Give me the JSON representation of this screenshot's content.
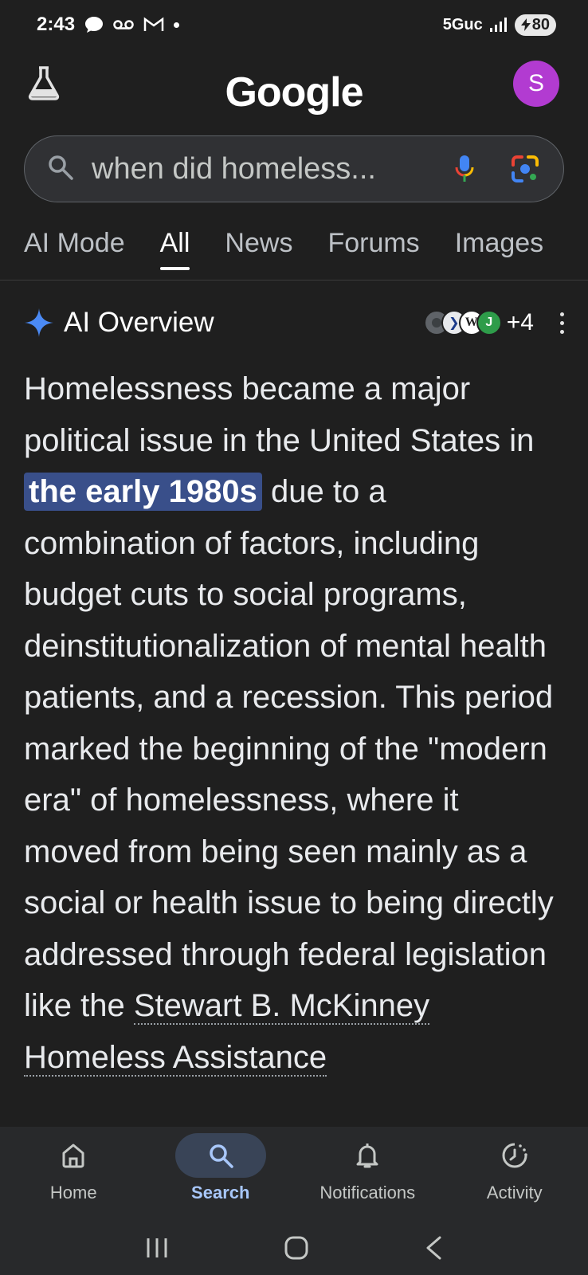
{
  "status_bar": {
    "time": "2:43",
    "network": "5Guc",
    "battery": "80",
    "icons": [
      "chat-bubble-icon",
      "voicemail-icon",
      "gmail-icon",
      "dot-icon",
      "signal-icon",
      "battery-icon"
    ]
  },
  "header": {
    "logo": "Google",
    "avatar_letter": "S",
    "avatar_color": "#b23bd1"
  },
  "search": {
    "query": "when did homeless..."
  },
  "tabs": [
    {
      "label": "AI Mode"
    },
    {
      "label": "All",
      "active": true
    },
    {
      "label": "News"
    },
    {
      "label": "Forums"
    },
    {
      "label": "Images"
    }
  ],
  "ai_overview": {
    "title": "AI Overview",
    "source_count": "+4",
    "text_before": "Homelessness became a major political issue in the United States in ",
    "highlight": "the early 1980s",
    "text_middle": " due to a combination of factors, including budget cuts to social programs, deinstitutionalization of mental health patients, and a recession. This period marked the beginning of the \"modern era\" of homelessness, where it moved from being seen mainly as a social or health issue to being directly addressed through federal legislation like the ",
    "link_text": "Stewart B. McKinney Homeless Assistance"
  },
  "bottom_nav": [
    {
      "label": "Home",
      "icon": "home-icon"
    },
    {
      "label": "Search",
      "icon": "search-icon",
      "active": true
    },
    {
      "label": "Notifications",
      "icon": "bell-icon"
    },
    {
      "label": "Activity",
      "icon": "activity-icon"
    }
  ],
  "colors": {
    "background": "#1f1f1f",
    "highlight": "#394f8a",
    "active_nav": "#a8c7fa"
  }
}
